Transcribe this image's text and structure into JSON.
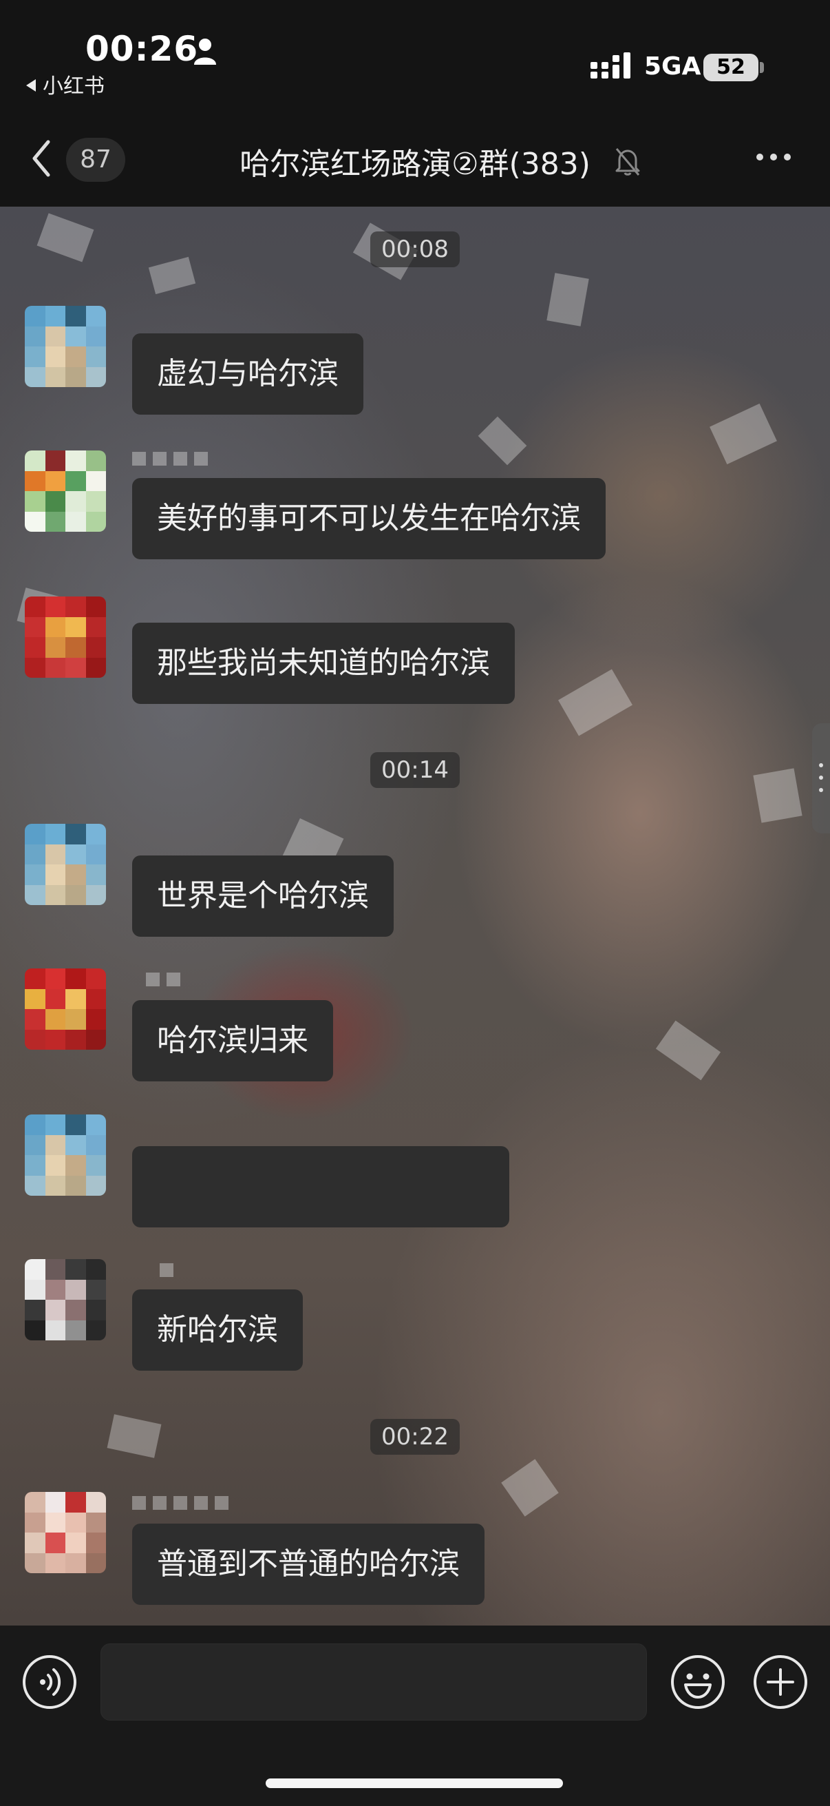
{
  "status_bar": {
    "time": "00:26",
    "back_app": "小红书",
    "network": "5GA",
    "battery": "52"
  },
  "header": {
    "unread_count": "87",
    "title": "哈尔滨红场路演②群(383)"
  },
  "messages": {
    "ts1": "00:08",
    "ts2": "00:14",
    "ts3": "00:22",
    "m1": "虚幻与哈尔滨",
    "m2": "美好的事可不可以发生在哈尔滨",
    "m3": "那些我尚未知道的哈尔滨",
    "m4": "世界是个哈尔滨",
    "m5": "哈尔滨归来",
    "m6": "",
    "m7": "新哈尔滨",
    "m8": "普通到不普通的哈尔滨"
  },
  "input": {
    "placeholder": ""
  },
  "icons": {
    "back": "chevron-left-icon",
    "mute": "bell-slash-icon",
    "more": "more-dots-icon",
    "voice": "voice-icon",
    "emoji": "emoji-icon",
    "plus": "plus-icon"
  },
  "colors": {
    "bubble": "#2e2e2e",
    "bar_background": "#141414",
    "text": "#f0f0f0"
  }
}
